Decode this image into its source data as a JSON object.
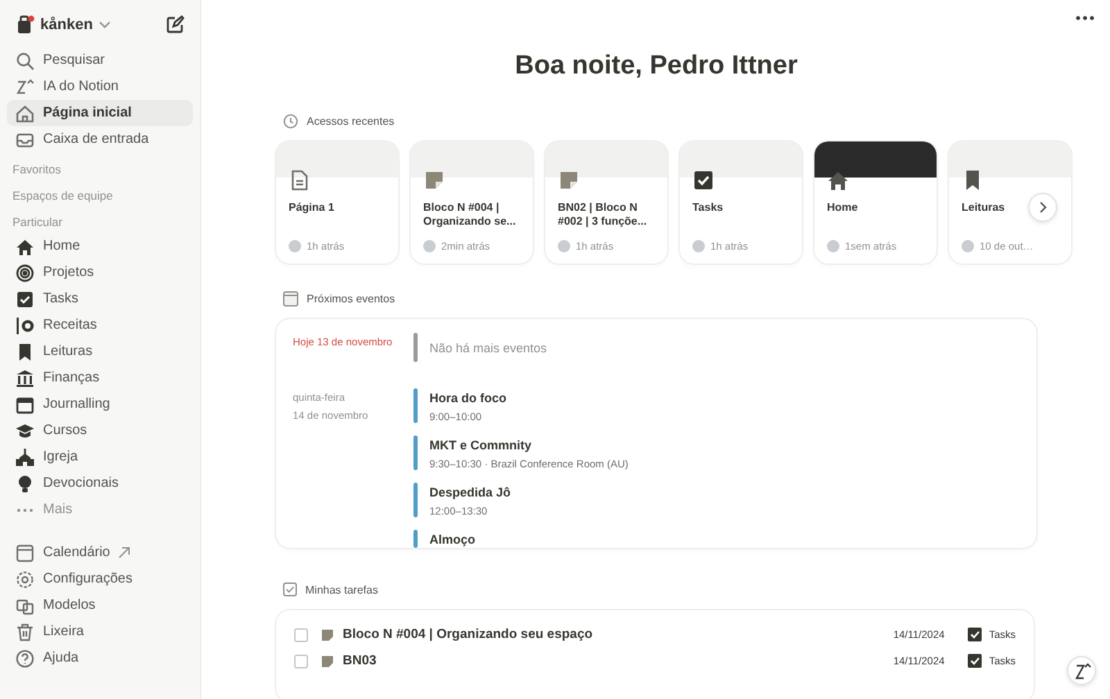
{
  "workspace": {
    "name": "kånken",
    "notification": true
  },
  "nav": [
    {
      "label": "Pesquisar",
      "selected": false
    },
    {
      "label": "IA do Notion",
      "selected": false
    },
    {
      "label": "Página inicial",
      "selected": true
    },
    {
      "label": "Caixa de entrada",
      "selected": false
    }
  ],
  "sections": [
    "Favoritos",
    "Espaços de equipe"
  ],
  "private": {
    "title": "Particular",
    "items": [
      {
        "label": "Home",
        "muted": false
      },
      {
        "label": "Projetos",
        "muted": false
      },
      {
        "label": "Tasks",
        "muted": false
      },
      {
        "label": "Receitas",
        "muted": false
      },
      {
        "label": "Leituras",
        "muted": false
      },
      {
        "label": "Finanças",
        "muted": false
      },
      {
        "label": "Journalling",
        "muted": false
      },
      {
        "label": "Cursos",
        "muted": false
      },
      {
        "label": "Igreja",
        "muted": false
      },
      {
        "label": "Devocionais",
        "muted": false
      },
      {
        "label": "Mais",
        "muted": true
      }
    ]
  },
  "footer": [
    {
      "label": "Calendário",
      "external": true
    },
    {
      "label": "Configurações",
      "external": false
    },
    {
      "label": "Modelos",
      "external": false
    },
    {
      "label": "Lixeira",
      "external": false
    },
    {
      "label": "Ajuda",
      "external": false
    }
  ],
  "greeting": "Boa noite, Pedro Ittner",
  "recent": {
    "title": "Acessos recentes",
    "cards": [
      {
        "title": "Página 1",
        "time": "1h atrás",
        "photo": false
      },
      {
        "title": "Bloco N #004 | Organizando se...",
        "time": "2min atrás",
        "photo": false
      },
      {
        "title": "BN02 | Bloco N #002 | 3 funçõe...",
        "time": "1h atrás",
        "photo": false
      },
      {
        "title": "Tasks",
        "time": "1h atrás",
        "photo": false
      },
      {
        "title": "Home",
        "time": "1sem atrás",
        "photo": true
      },
      {
        "title": "Leituras",
        "time": "10 de out…",
        "photo": false
      }
    ]
  },
  "events": {
    "title": "Próximos eventos",
    "days": [
      {
        "lines": [
          "Hoje 13 de novembro"
        ],
        "today": true,
        "events": [
          {
            "title": "Não há mais eventos",
            "kind": "empty",
            "color": "#9b9a97"
          }
        ]
      },
      {
        "lines": [
          "quinta-feira",
          "14 de novembro"
        ],
        "today": false,
        "events": [
          {
            "title": "Hora do foco",
            "time": "9:00–10:00",
            "kind": "event",
            "color": "#529cca"
          },
          {
            "title": "MKT e Commnity",
            "time": "9:30–10:30 · Brazil Conference Room (AU)",
            "kind": "event",
            "color": "#529cca"
          },
          {
            "title": "Despedida Jô",
            "time": "12:00–13:30",
            "kind": "event",
            "color": "#529cca"
          },
          {
            "title": "Almoço",
            "kind": "event",
            "color": "#529cca"
          }
        ]
      }
    ]
  },
  "tasks": {
    "title": "Minhas tarefas",
    "rows": [
      {
        "title": "Bloco N #004 | Organizando seu espaço",
        "date": "14/11/2024",
        "database": "Tasks",
        "checked": false
      },
      {
        "title": "BN03",
        "date": "14/11/2024",
        "database": "Tasks",
        "checked": false
      }
    ]
  }
}
